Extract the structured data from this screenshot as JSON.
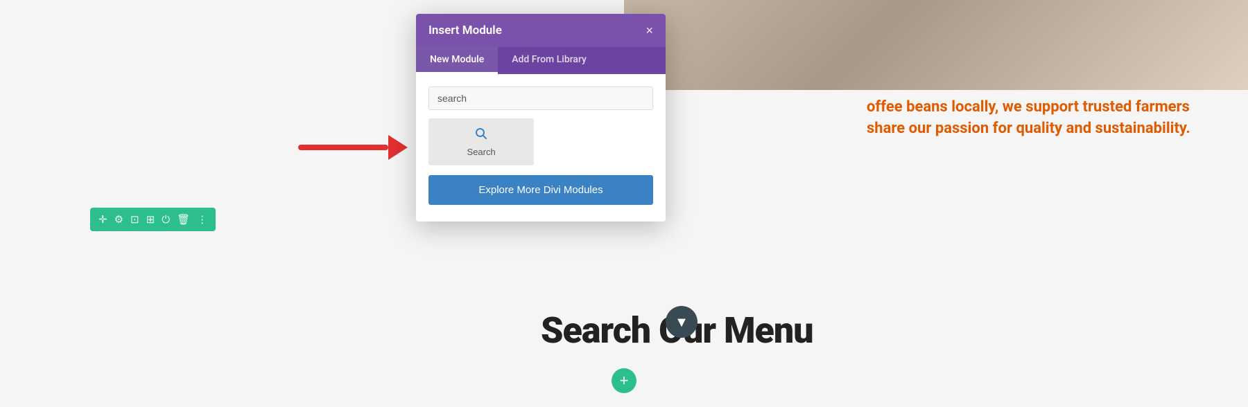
{
  "modal": {
    "title": "Insert Module",
    "close_label": "×",
    "tabs": [
      {
        "label": "New Module",
        "active": true
      },
      {
        "label": "Add From Library",
        "active": false
      }
    ],
    "search_placeholder": "search",
    "search_button_label": "Search",
    "explore_button_label": "Explore More Divi Modules"
  },
  "background": {
    "orange_text_line1": "offee beans locally, we support trusted farmers",
    "orange_text_line2": "share our passion for quality and sustainability.",
    "heading": "Search Our Menu"
  },
  "toolbar": {
    "icons": [
      "✛",
      "⚙",
      "⊡",
      "⊞",
      "⏻",
      "🗑",
      "⋮"
    ]
  },
  "colors": {
    "purple_header": "#7b52ab",
    "purple_tabs": "#6a44a0",
    "green": "#2dbe8e",
    "blue": "#3b82c4",
    "orange": "#e05a00",
    "red_arrow": "#e03030"
  }
}
